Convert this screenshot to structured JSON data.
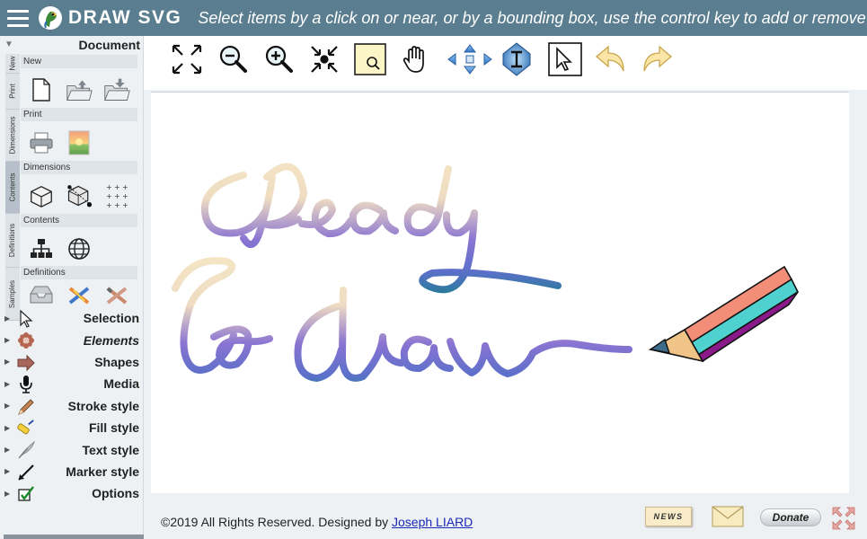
{
  "header": {
    "app_title": "DRAW SVG",
    "hint": "Select items by a click on or near, or by a bounding box, use the control key to add or remove",
    "background_color": "#5a7d8f"
  },
  "left_panel": {
    "document_title": "Document",
    "vertical_tabs": [
      "New",
      "Print",
      "Dimensions",
      "Contents",
      "Definitions",
      "Samples"
    ],
    "sections": [
      {
        "title": "New",
        "icons": [
          "new-document-icon",
          "open-folder-icon",
          "save-folder-icon"
        ]
      },
      {
        "title": "Print",
        "icons": [
          "printer-icon",
          "export-image-icon"
        ]
      },
      {
        "title": "Dimensions",
        "icons": [
          "box-dimensions-icon",
          "box-resize-icon",
          "grid-icon"
        ]
      },
      {
        "title": "Contents",
        "icons": [
          "tree-structure-icon",
          "globe-icon"
        ]
      },
      {
        "title": "Definitions",
        "icons": [
          "inbox-icon",
          "crossed-tools-icon",
          "crossed-brushes-icon"
        ]
      }
    ],
    "menu": [
      {
        "label": "Selection",
        "icon": "cursor-arrow-icon",
        "italic": false
      },
      {
        "label": "Elements",
        "icon": "flower-icon",
        "italic": true
      },
      {
        "label": "Shapes",
        "icon": "arrow-shape-icon",
        "italic": false
      },
      {
        "label": "Media",
        "icon": "microphone-icon",
        "italic": false
      },
      {
        "label": "Stroke style",
        "icon": "pencil-icon",
        "italic": false
      },
      {
        "label": "Fill style",
        "icon": "paint-roller-icon",
        "italic": false
      },
      {
        "label": "Text style",
        "icon": "quill-icon",
        "italic": false
      },
      {
        "label": "Marker style",
        "icon": "marker-icon",
        "italic": false
      },
      {
        "label": "Options",
        "icon": "checkbox-icon",
        "italic": false
      }
    ]
  },
  "toolbar": {
    "tools": [
      "fit-screen-icon",
      "zoom-out-icon",
      "zoom-in-icon",
      "collapse-icon",
      "zoom-area-icon",
      "hand-pan-icon",
      "move-arrows-icon",
      "vertical-center-icon",
      "select-pointer-icon",
      "undo-icon",
      "redo-icon"
    ]
  },
  "canvas": {
    "line1": "Ready",
    "line2": "to draw"
  },
  "footer": {
    "copyright": "©2019 All Rights Reserved. Designed by ",
    "author": "Joseph LIARD",
    "news_label": "NEWS",
    "donate_label": "Donate"
  }
}
